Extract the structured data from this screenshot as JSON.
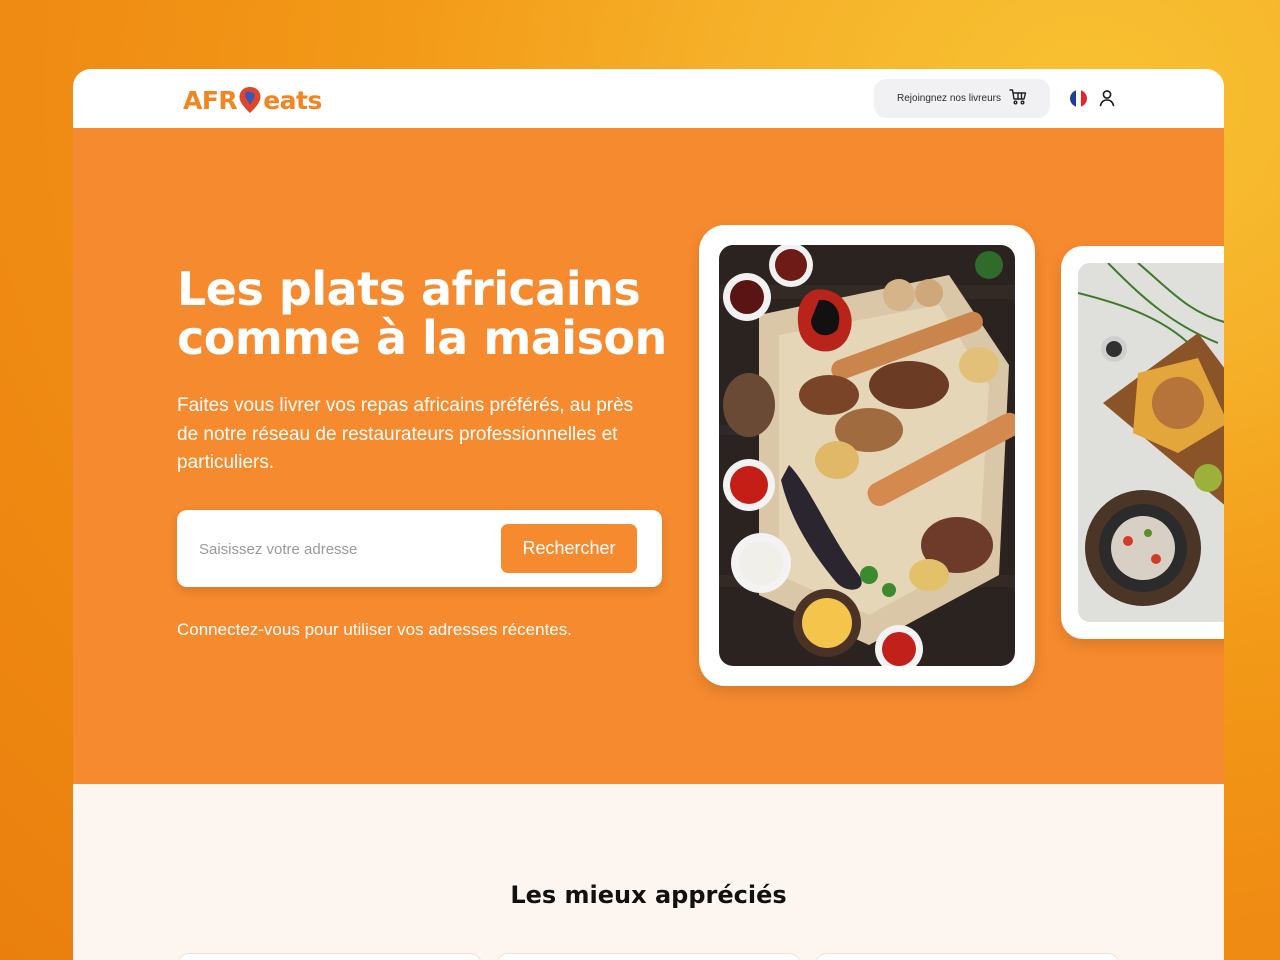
{
  "header": {
    "logo_prefix": "AFR",
    "logo_suffix": "eats",
    "join_label": "Rejoingnez nos livreurs"
  },
  "hero": {
    "headline": "Les plats africains comme à la maison",
    "subtitle": "Faites vous livrer vos repas africains préférés,  au près de notre réseau de restaurateurs professionnelles et particuliers.",
    "search_placeholder": "Saisissez votre adresse",
    "search_button": "Rechercher",
    "login_hint": "Connectez-vous pour utiliser vos adresses récentes."
  },
  "featured": {
    "title": "Les mieux appréciés"
  },
  "colors": {
    "brand_orange": "#f68a2e",
    "logo_orange": "#f2851f",
    "logo_pin": "#e0452a",
    "page_bg": "#fdf6f0"
  },
  "icons": [
    "pin-logo-icon",
    "delivery-cart-icon",
    "french-flag-icon",
    "user-icon"
  ]
}
